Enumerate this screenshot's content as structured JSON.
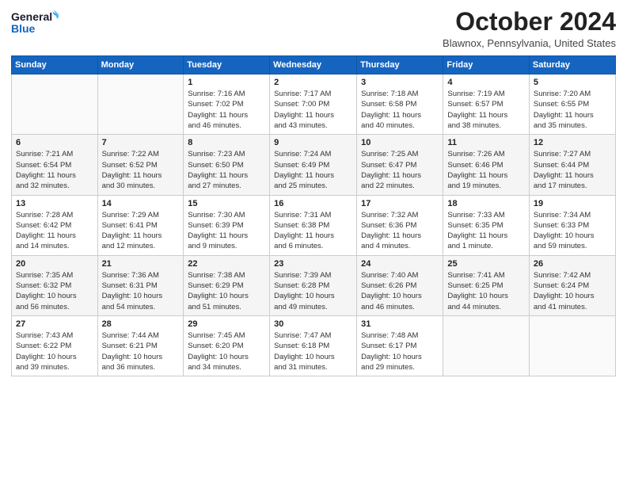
{
  "logo": {
    "line1": "General",
    "line2": "Blue"
  },
  "title": "October 2024",
  "location": "Blawnox, Pennsylvania, United States",
  "days_of_week": [
    "Sunday",
    "Monday",
    "Tuesday",
    "Wednesday",
    "Thursday",
    "Friday",
    "Saturday"
  ],
  "weeks": [
    [
      {
        "day": "",
        "detail": ""
      },
      {
        "day": "",
        "detail": ""
      },
      {
        "day": "1",
        "detail": "Sunrise: 7:16 AM\nSunset: 7:02 PM\nDaylight: 11 hours\nand 46 minutes."
      },
      {
        "day": "2",
        "detail": "Sunrise: 7:17 AM\nSunset: 7:00 PM\nDaylight: 11 hours\nand 43 minutes."
      },
      {
        "day": "3",
        "detail": "Sunrise: 7:18 AM\nSunset: 6:58 PM\nDaylight: 11 hours\nand 40 minutes."
      },
      {
        "day": "4",
        "detail": "Sunrise: 7:19 AM\nSunset: 6:57 PM\nDaylight: 11 hours\nand 38 minutes."
      },
      {
        "day": "5",
        "detail": "Sunrise: 7:20 AM\nSunset: 6:55 PM\nDaylight: 11 hours\nand 35 minutes."
      }
    ],
    [
      {
        "day": "6",
        "detail": "Sunrise: 7:21 AM\nSunset: 6:54 PM\nDaylight: 11 hours\nand 32 minutes."
      },
      {
        "day": "7",
        "detail": "Sunrise: 7:22 AM\nSunset: 6:52 PM\nDaylight: 11 hours\nand 30 minutes."
      },
      {
        "day": "8",
        "detail": "Sunrise: 7:23 AM\nSunset: 6:50 PM\nDaylight: 11 hours\nand 27 minutes."
      },
      {
        "day": "9",
        "detail": "Sunrise: 7:24 AM\nSunset: 6:49 PM\nDaylight: 11 hours\nand 25 minutes."
      },
      {
        "day": "10",
        "detail": "Sunrise: 7:25 AM\nSunset: 6:47 PM\nDaylight: 11 hours\nand 22 minutes."
      },
      {
        "day": "11",
        "detail": "Sunrise: 7:26 AM\nSunset: 6:46 PM\nDaylight: 11 hours\nand 19 minutes."
      },
      {
        "day": "12",
        "detail": "Sunrise: 7:27 AM\nSunset: 6:44 PM\nDaylight: 11 hours\nand 17 minutes."
      }
    ],
    [
      {
        "day": "13",
        "detail": "Sunrise: 7:28 AM\nSunset: 6:42 PM\nDaylight: 11 hours\nand 14 minutes."
      },
      {
        "day": "14",
        "detail": "Sunrise: 7:29 AM\nSunset: 6:41 PM\nDaylight: 11 hours\nand 12 minutes."
      },
      {
        "day": "15",
        "detail": "Sunrise: 7:30 AM\nSunset: 6:39 PM\nDaylight: 11 hours\nand 9 minutes."
      },
      {
        "day": "16",
        "detail": "Sunrise: 7:31 AM\nSunset: 6:38 PM\nDaylight: 11 hours\nand 6 minutes."
      },
      {
        "day": "17",
        "detail": "Sunrise: 7:32 AM\nSunset: 6:36 PM\nDaylight: 11 hours\nand 4 minutes."
      },
      {
        "day": "18",
        "detail": "Sunrise: 7:33 AM\nSunset: 6:35 PM\nDaylight: 11 hours\nand 1 minute."
      },
      {
        "day": "19",
        "detail": "Sunrise: 7:34 AM\nSunset: 6:33 PM\nDaylight: 10 hours\nand 59 minutes."
      }
    ],
    [
      {
        "day": "20",
        "detail": "Sunrise: 7:35 AM\nSunset: 6:32 PM\nDaylight: 10 hours\nand 56 minutes."
      },
      {
        "day": "21",
        "detail": "Sunrise: 7:36 AM\nSunset: 6:31 PM\nDaylight: 10 hours\nand 54 minutes."
      },
      {
        "day": "22",
        "detail": "Sunrise: 7:38 AM\nSunset: 6:29 PM\nDaylight: 10 hours\nand 51 minutes."
      },
      {
        "day": "23",
        "detail": "Sunrise: 7:39 AM\nSunset: 6:28 PM\nDaylight: 10 hours\nand 49 minutes."
      },
      {
        "day": "24",
        "detail": "Sunrise: 7:40 AM\nSunset: 6:26 PM\nDaylight: 10 hours\nand 46 minutes."
      },
      {
        "day": "25",
        "detail": "Sunrise: 7:41 AM\nSunset: 6:25 PM\nDaylight: 10 hours\nand 44 minutes."
      },
      {
        "day": "26",
        "detail": "Sunrise: 7:42 AM\nSunset: 6:24 PM\nDaylight: 10 hours\nand 41 minutes."
      }
    ],
    [
      {
        "day": "27",
        "detail": "Sunrise: 7:43 AM\nSunset: 6:22 PM\nDaylight: 10 hours\nand 39 minutes."
      },
      {
        "day": "28",
        "detail": "Sunrise: 7:44 AM\nSunset: 6:21 PM\nDaylight: 10 hours\nand 36 minutes."
      },
      {
        "day": "29",
        "detail": "Sunrise: 7:45 AM\nSunset: 6:20 PM\nDaylight: 10 hours\nand 34 minutes."
      },
      {
        "day": "30",
        "detail": "Sunrise: 7:47 AM\nSunset: 6:18 PM\nDaylight: 10 hours\nand 31 minutes."
      },
      {
        "day": "31",
        "detail": "Sunrise: 7:48 AM\nSunset: 6:17 PM\nDaylight: 10 hours\nand 29 minutes."
      },
      {
        "day": "",
        "detail": ""
      },
      {
        "day": "",
        "detail": ""
      }
    ]
  ]
}
